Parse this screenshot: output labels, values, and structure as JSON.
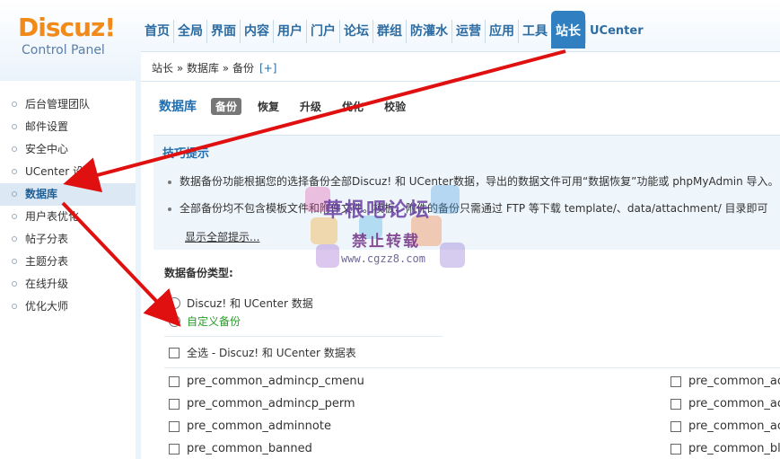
{
  "header": {
    "logo_brand": "Discuz!",
    "logo_sub": "Control Panel",
    "nav": [
      {
        "label": "首页"
      },
      {
        "label": "全局"
      },
      {
        "label": "界面"
      },
      {
        "label": "内容"
      },
      {
        "label": "用户"
      },
      {
        "label": "门户"
      },
      {
        "label": "论坛"
      },
      {
        "label": "群组"
      },
      {
        "label": "防灌水"
      },
      {
        "label": "运营"
      },
      {
        "label": "应用"
      },
      {
        "label": "工具"
      },
      {
        "label": "站长",
        "active": true
      },
      {
        "label": "UCenter"
      }
    ]
  },
  "breadcrumb": {
    "text": "站长 » 数据库 » 备份",
    "plus": "[+]"
  },
  "sidebar": {
    "items": [
      {
        "label": "后台管理团队"
      },
      {
        "label": "邮件设置"
      },
      {
        "label": "安全中心"
      },
      {
        "label": "UCenter 设置"
      },
      {
        "label": "数据库",
        "active": true
      },
      {
        "label": "用户表优化"
      },
      {
        "label": "帖子分表"
      },
      {
        "label": "主题分表"
      },
      {
        "label": "在线升级"
      },
      {
        "label": "优化大师"
      }
    ]
  },
  "main": {
    "title": "数据库",
    "tabs": [
      {
        "label": "备份",
        "active": true
      },
      {
        "label": "恢复"
      },
      {
        "label": "升级"
      },
      {
        "label": "优化"
      },
      {
        "label": "校验"
      }
    ],
    "tips_title": "技巧提示",
    "tips": [
      "数据备份功能根据您的选择备份全部Discuz! 和 UCenter数据，导出的数据文件可用“数据恢复”功能或 phpMyAdmin 导入。",
      "全部备份均不包含模板文件和附件文件。模板、附件的备份只需通过 FTP 等下载 template/、data/attachment/ 目录即可"
    ],
    "show_all": "显示全部提示...",
    "backup_type_label": "数据备份类型:",
    "radio_options": [
      {
        "label": "Discuz! 和 UCenter 数据",
        "checked": false
      },
      {
        "label": "自定义备份",
        "checked": true
      }
    ],
    "select_all_label": "全选 - Discuz! 和 UCenter 数据表",
    "tables_left": [
      "pre_common_admincp_cmenu",
      "pre_common_admincp_perm",
      "pre_common_adminnote",
      "pre_common_banned"
    ],
    "tables_right": [
      "pre_common_ac",
      "pre_common_ac",
      "pre_common_ac",
      "pre_common_blo"
    ]
  },
  "watermark": {
    "title": "草根吧论坛",
    "subtitle": "禁止转载",
    "url": "www.cgzz8.com"
  },
  "colors": {
    "accent": "#2f7fc1",
    "arrow": "#e01010",
    "logo_orange": "#f28a1a",
    "checked_green": "#2a9a2a"
  }
}
